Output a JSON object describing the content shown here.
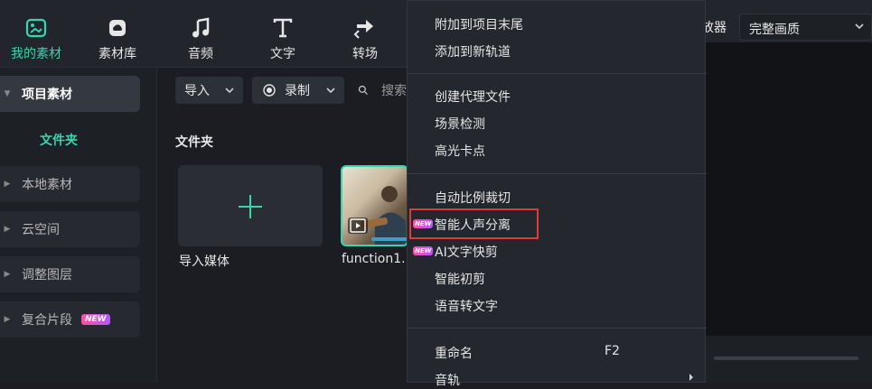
{
  "toolbar": {
    "tools": [
      {
        "label": "我的素材",
        "icon": "folder-media-icon",
        "active": true
      },
      {
        "label": "素材库",
        "icon": "cloud-library-icon"
      },
      {
        "label": "音频",
        "icon": "music-note-icon"
      },
      {
        "label": "文字",
        "icon": "text-t-icon"
      },
      {
        "label": "转场",
        "icon": "transition-icon"
      }
    ],
    "quality_label_fragment": "放器",
    "quality_value": "完整画质"
  },
  "sidebar": {
    "items": [
      {
        "label": "项目素材",
        "expanded": true
      },
      {
        "label": "文件夹"
      },
      {
        "label": "本地素材"
      },
      {
        "label": "云空间"
      },
      {
        "label": "调整图层"
      },
      {
        "label": "复合片段",
        "badge": "NEW"
      }
    ]
  },
  "main": {
    "import_label": "导入",
    "record_label": "录制",
    "search_placeholder": "搜索",
    "folder_title": "文件夹",
    "import_media_label": "导入媒体",
    "video_label": "function1."
  },
  "menu": {
    "items": [
      {
        "label": "附加到项目末尾"
      },
      {
        "label": "添加到新轨道"
      },
      {
        "label": "创建代理文件"
      },
      {
        "label": "场景检测"
      },
      {
        "label": "高光卡点"
      },
      {
        "label": "自动比例裁切"
      },
      {
        "label": "智能人声分离",
        "badge": "NEW",
        "highlighted": true
      },
      {
        "label": "AI文字快剪",
        "badge": "NEW"
      },
      {
        "label": "智能初剪"
      },
      {
        "label": "语音转文字"
      },
      {
        "label": "重命名",
        "shortcut": "F2"
      },
      {
        "label": "音轨",
        "submenu": true
      }
    ]
  },
  "colors": {
    "accent": "#35d6b0",
    "highlight_border": "#e03a3a",
    "background": "#1b1d22"
  }
}
